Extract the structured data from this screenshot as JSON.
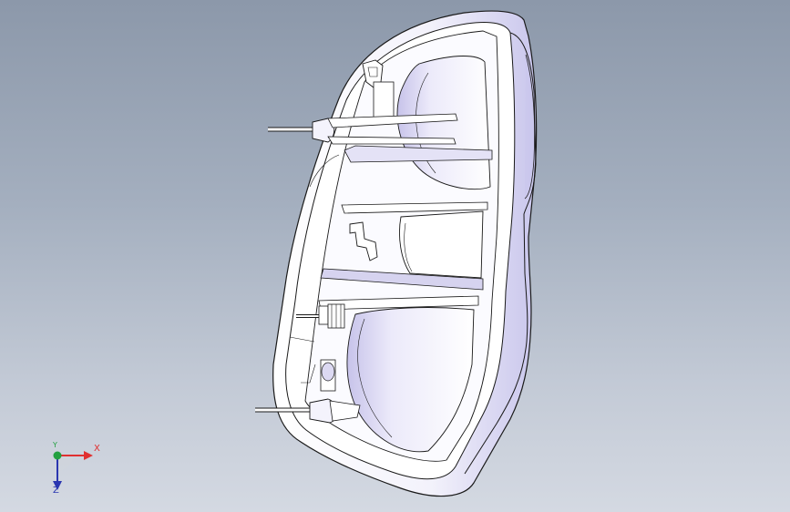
{
  "viewport": {
    "background_top": "#8c98aa",
    "background_bottom": "#d4d9e2"
  },
  "model": {
    "name_icon": "tail-lamp-housing-3d-model",
    "fill_color": "#ffffff",
    "shade_color": "#c9c6ec",
    "edge_color": "#1a1a1a"
  },
  "triad": {
    "x_label": "X",
    "y_label": "Y",
    "z_label": "Z",
    "x_color": "#e03030",
    "y_color": "#22a040",
    "z_color": "#2a36b0"
  }
}
